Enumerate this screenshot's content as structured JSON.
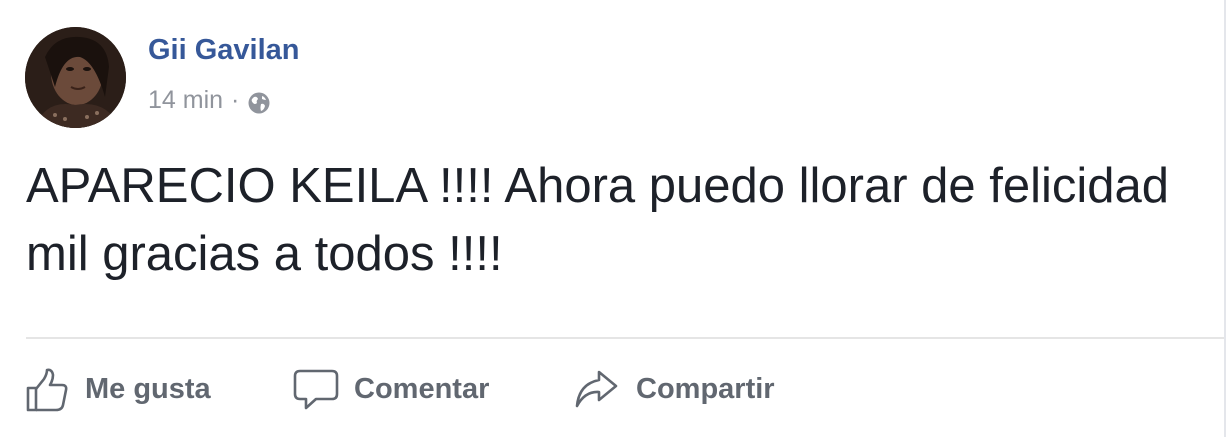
{
  "post": {
    "author": "Gii Gavilan",
    "time": "14 min",
    "separator": "·",
    "audience_icon": "globe-icon",
    "text": "APARECIO KEILA !!!! Ahora puedo llorar de felicidad mil gracias a todos !!!!"
  },
  "actions": {
    "like": {
      "label": "Me gusta",
      "icon": "thumbs-up-icon"
    },
    "comment": {
      "label": "Comentar",
      "icon": "comment-bubble-icon"
    },
    "share": {
      "label": "Compartir",
      "icon": "share-arrow-icon"
    }
  },
  "colors": {
    "author": "#365899",
    "meta": "#90949c",
    "body_text": "#1d2129",
    "action_text": "#616770",
    "divider": "#e5e5e5"
  }
}
